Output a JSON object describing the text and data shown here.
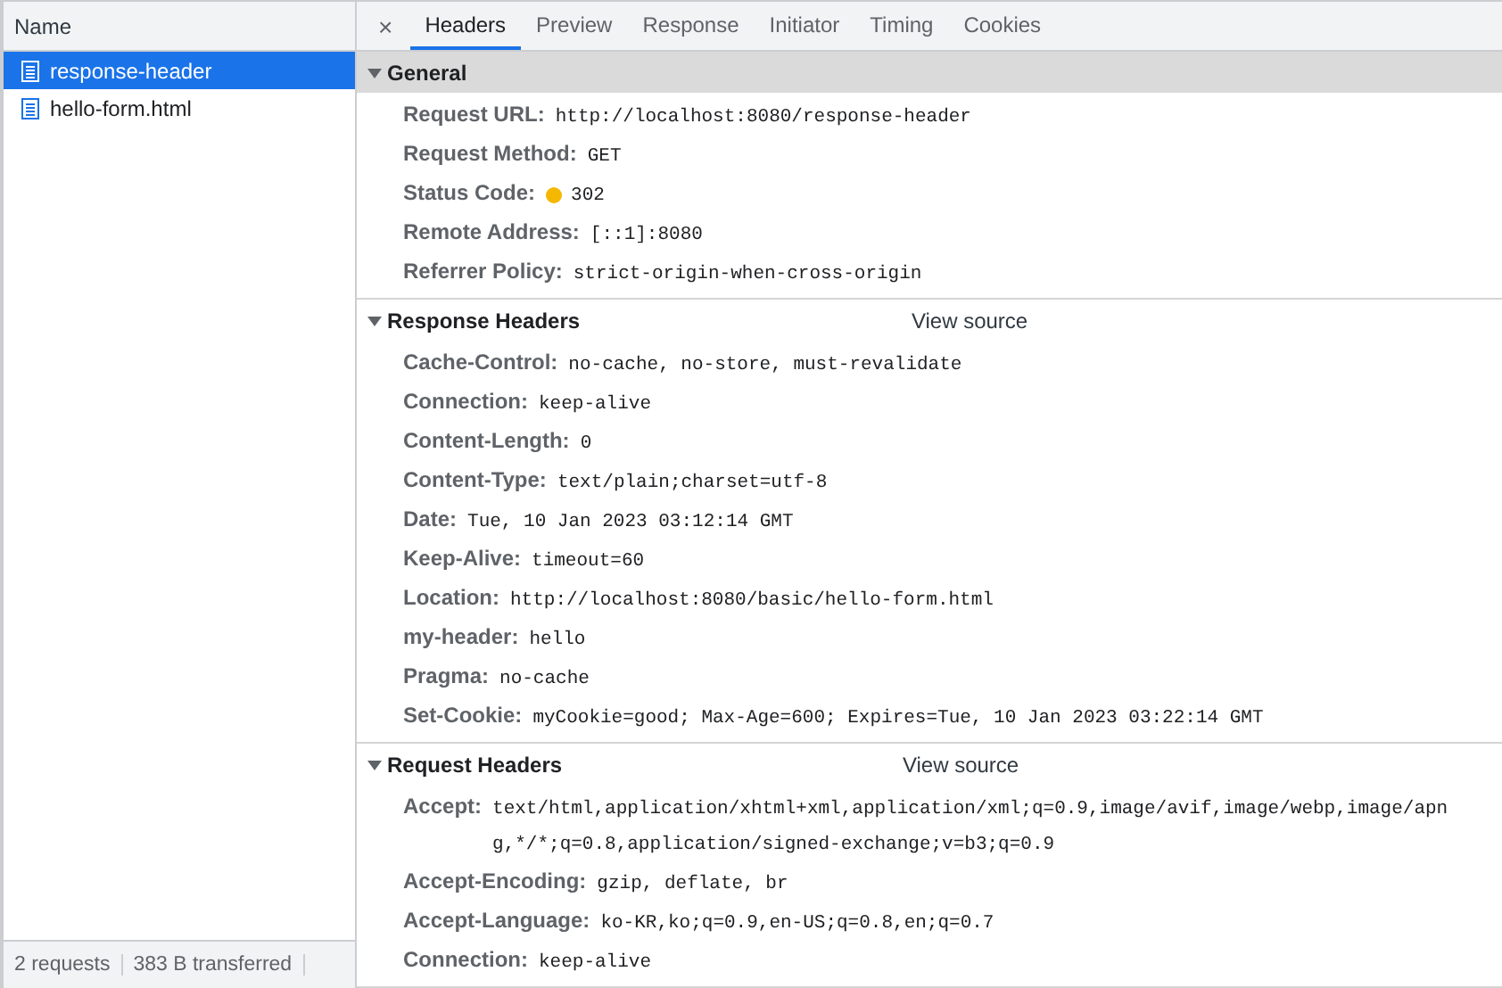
{
  "requests": {
    "column": "Name",
    "items": [
      {
        "name": "response-header",
        "selected": true
      },
      {
        "name": "hello-form.html",
        "selected": false
      }
    ]
  },
  "status_bar": [
    "2 requests",
    "383 B transferred"
  ],
  "close": "×",
  "tabs": [
    {
      "label": "Headers",
      "selected": true
    },
    {
      "label": "Preview",
      "selected": false
    },
    {
      "label": "Response",
      "selected": false
    },
    {
      "label": "Initiator",
      "selected": false
    },
    {
      "label": "Timing",
      "selected": false
    },
    {
      "label": "Cookies",
      "selected": false
    }
  ],
  "sections": [
    {
      "title": "General",
      "expanded": true,
      "highlighted": true,
      "rows": [
        {
          "name": "Request URL:",
          "value": "http://localhost:8080/response-header"
        },
        {
          "name": "Request Method:",
          "value": "GET"
        },
        {
          "name": "Status Code:",
          "value": "302",
          "color": "#f5b700"
        },
        {
          "name": "Remote Address:",
          "value": "[::1]:8080"
        },
        {
          "name": "Referrer Policy:",
          "value": "strict-origin-when-cross-origin"
        }
      ]
    },
    {
      "title": "Response Headers",
      "expanded": true,
      "highlighted": false,
      "view_source": "View source",
      "rows": [
        {
          "name": "Cache-Control:",
          "value": "no-cache, no-store, must-revalidate"
        },
        {
          "name": "Connection:",
          "value": "keep-alive"
        },
        {
          "name": "Content-Length:",
          "value": "0"
        },
        {
          "name": "Content-Type:",
          "value": "text/plain;charset=utf-8"
        },
        {
          "name": "Date:",
          "value": "Tue, 10 Jan 2023 03:12:14 GMT"
        },
        {
          "name": "Keep-Alive:",
          "value": "timeout=60"
        },
        {
          "name": "Location:",
          "value": "http://localhost:8080/basic/hello-form.html"
        },
        {
          "name": "my-header:",
          "value": "hello"
        },
        {
          "name": "Pragma:",
          "value": "no-cache"
        },
        {
          "name": "Set-Cookie:",
          "value": "myCookie=good; Max-Age=600; Expires=Tue, 10 Jan 2023 03:22:14 GMT"
        }
      ]
    },
    {
      "title": "Request Headers",
      "expanded": true,
      "highlighted": false,
      "view_source": "View source",
      "rows": [
        {
          "name": "Accept:",
          "value": "text/html,application/xhtml+xml,application/xml;q=0.9,image/avif,image/webp,image/apng,*/*;q=0.8,application/signed-exchange;v=b3;q=0.9"
        },
        {
          "name": "Accept-Encoding:",
          "value": "gzip, deflate, br"
        },
        {
          "name": "Accept-Language:",
          "value": "ko-KR,ko;q=0.9,en-US;q=0.8,en;q=0.7"
        },
        {
          "name": "Connection:",
          "value": "keep-alive"
        }
      ]
    }
  ]
}
